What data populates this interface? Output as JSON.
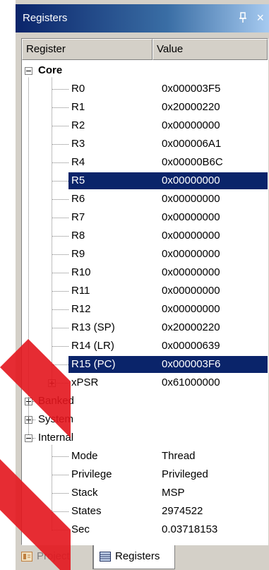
{
  "window": {
    "title": "Registers",
    "close_glyph": "×"
  },
  "columns": {
    "register": "Register",
    "value": "Value"
  },
  "core": {
    "label": "Core",
    "registers": [
      {
        "name": "R0",
        "value": "0x000003F5"
      },
      {
        "name": "R1",
        "value": "0x20000220"
      },
      {
        "name": "R2",
        "value": "0x00000000"
      },
      {
        "name": "R3",
        "value": "0x000006A1"
      },
      {
        "name": "R4",
        "value": "0x00000B6C"
      },
      {
        "name": "R5",
        "value": "0x00000000",
        "selected": true
      },
      {
        "name": "R6",
        "value": "0x00000000"
      },
      {
        "name": "R7",
        "value": "0x00000000"
      },
      {
        "name": "R8",
        "value": "0x00000000"
      },
      {
        "name": "R9",
        "value": "0x00000000"
      },
      {
        "name": "R10",
        "value": "0x00000000"
      },
      {
        "name": "R11",
        "value": "0x00000000"
      },
      {
        "name": "R12",
        "value": "0x00000000"
      },
      {
        "name": "R13 (SP)",
        "value": "0x20000220"
      },
      {
        "name": "R14 (LR)",
        "value": "0x00000639"
      },
      {
        "name": "R15 (PC)",
        "value": "0x000003F6",
        "selected": true
      }
    ],
    "xpsr": {
      "name": "xPSR",
      "value": "0x61000000"
    }
  },
  "groups": [
    {
      "label": "Banked",
      "expanded": false
    },
    {
      "label": "System",
      "expanded": false
    }
  ],
  "internal": {
    "label": "Internal",
    "items": [
      {
        "name": "Mode",
        "value": "Thread"
      },
      {
        "name": "Privilege",
        "value": "Privileged"
      },
      {
        "name": "Stack",
        "value": "MSP"
      },
      {
        "name": "States",
        "value": "2974522"
      },
      {
        "name": "Sec",
        "value": "0.03718153"
      }
    ]
  },
  "tabs": [
    {
      "label": "Project",
      "active": false
    },
    {
      "label": "Registers",
      "active": true
    }
  ],
  "colors": {
    "selection": "#0a246a",
    "title_start": "#0a246a",
    "title_end": "#a6caf0",
    "watermark": "#e3151d"
  }
}
